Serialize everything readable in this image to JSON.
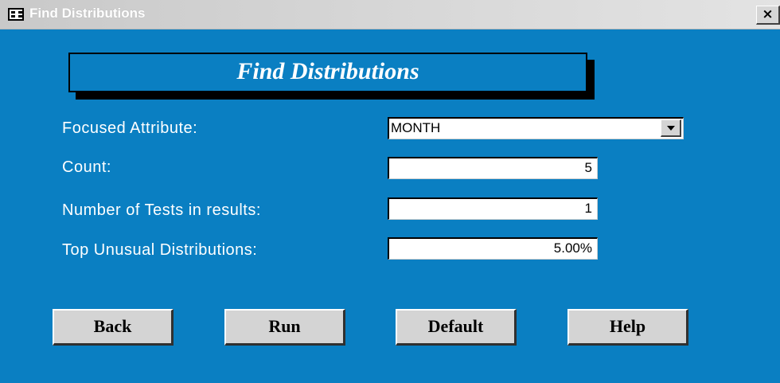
{
  "window": {
    "title": "Find Distributions",
    "close_label": "×"
  },
  "header": {
    "title": "Find Distributions"
  },
  "form": {
    "focused_attribute": {
      "label": "Focused Attribute:",
      "value": "MONTH"
    },
    "count": {
      "label": "Count:",
      "value": "5"
    },
    "num_tests": {
      "label": "Number of Tests in results:",
      "value": "1"
    },
    "top_unusual": {
      "label": "Top Unusual Distributions:",
      "value": "5.00%"
    }
  },
  "buttons": {
    "back": "Back",
    "run": "Run",
    "default": "Default",
    "help": "Help"
  },
  "colors": {
    "background": "#0a7fc2",
    "titlebar": "#d0d0d0",
    "button_face": "#d4d4d4"
  }
}
